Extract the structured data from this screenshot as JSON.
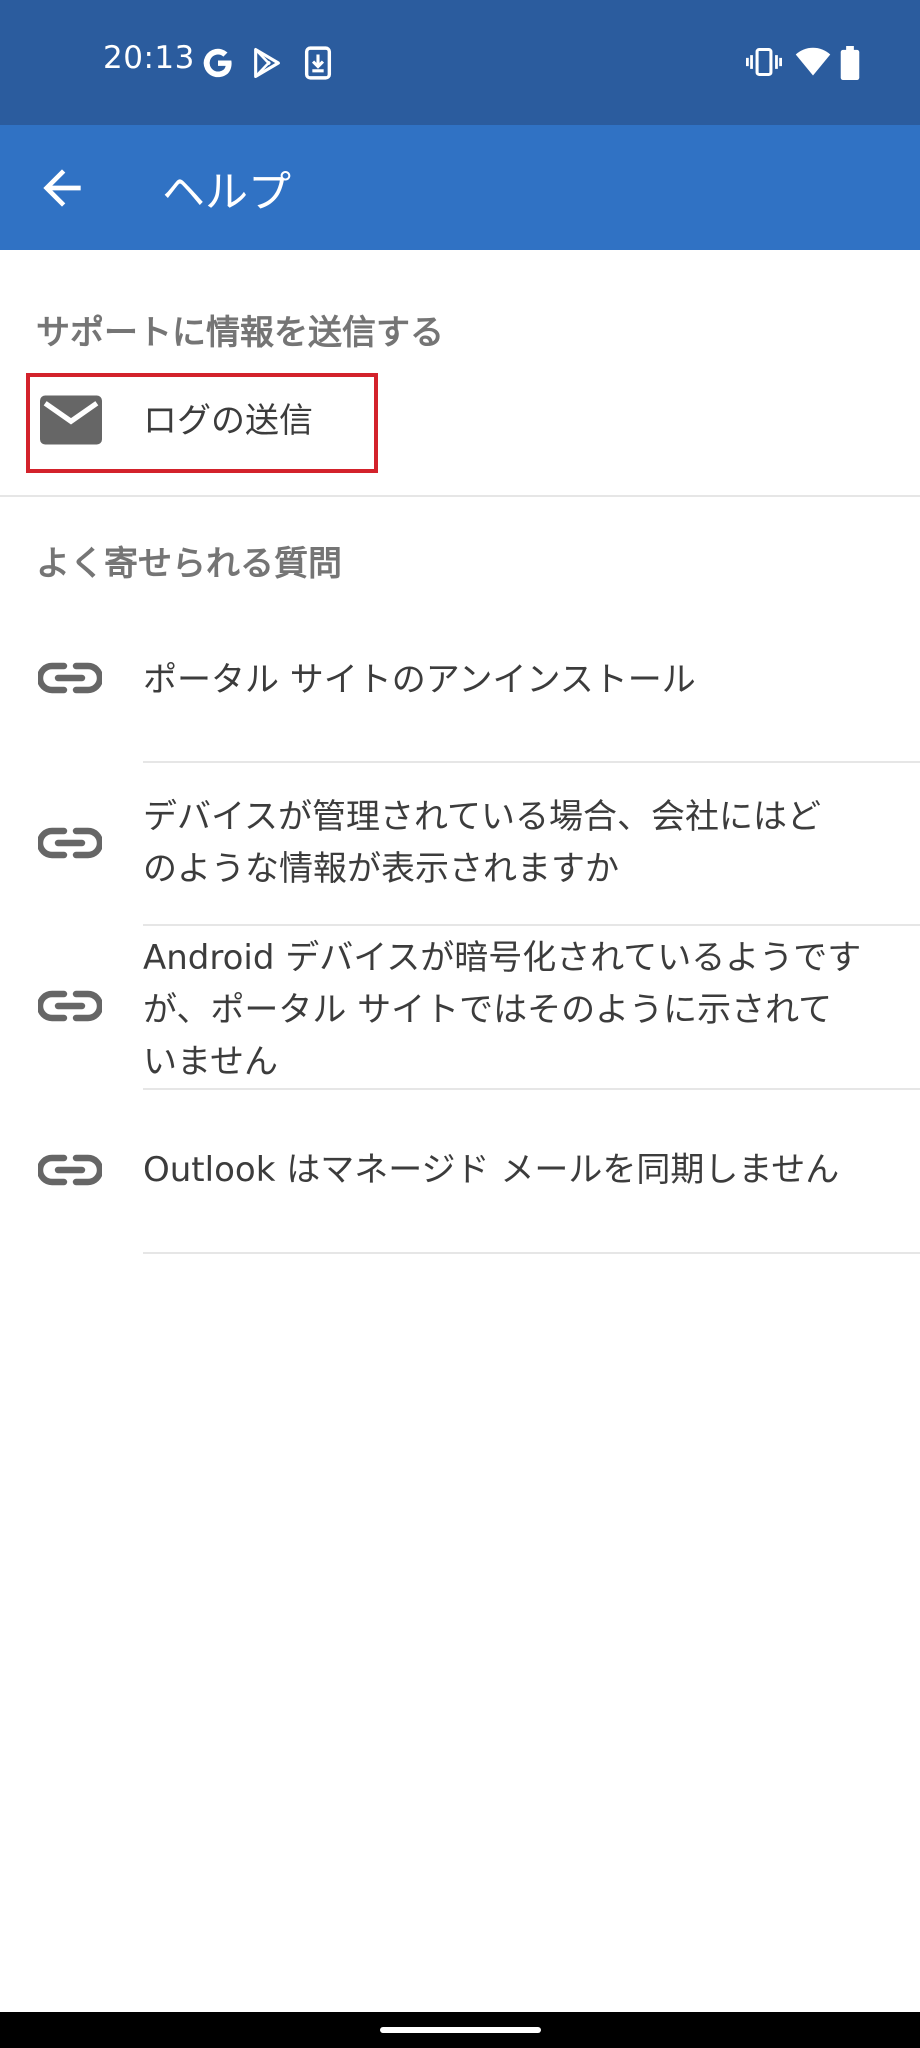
{
  "status_bar": {
    "time": "20:13",
    "left_icons": [
      "google-icon",
      "play-store-icon",
      "download-icon"
    ],
    "right_icons": [
      "vibrate-icon",
      "wifi-icon",
      "battery-icon"
    ]
  },
  "app_bar": {
    "title": "ヘルプ",
    "back_icon": "arrow-back-icon"
  },
  "support_section": {
    "header": "サポートに情報を送信する",
    "item_label": "ログの送信",
    "item_icon": "mail-icon"
  },
  "faq_section": {
    "header": "よく寄せられる質問",
    "items": [
      {
        "label": "ポータル サイトのアンインストール",
        "icon": "link-icon"
      },
      {
        "line1": "デバイスが管理されている場合、会社にはど",
        "line2": "のような情報が表示されますか",
        "icon": "link-icon"
      },
      {
        "line1": "Android デバイスが暗号化されているようです",
        "line2": "が、ポータル サイトではそのように示されて",
        "line3": "いません",
        "icon": "link-icon"
      },
      {
        "label": "Outlook はマネージド メールを同期しません",
        "icon": "link-icon"
      }
    ]
  },
  "colors": {
    "status_bar": "#2B5C9E",
    "app_bar": "#3072C4",
    "highlight": "#D3222B",
    "section_header": "#757575"
  }
}
